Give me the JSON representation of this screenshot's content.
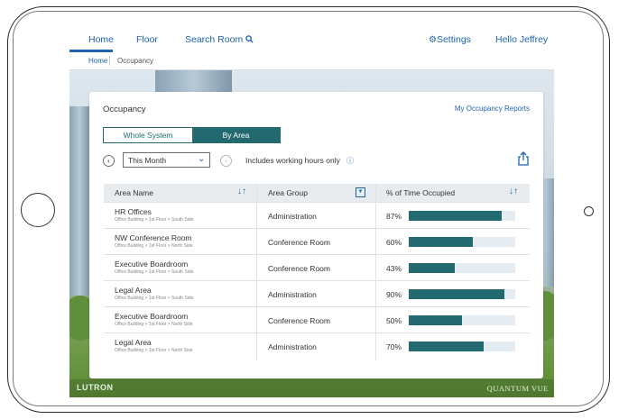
{
  "nav": {
    "home": "Home",
    "floor": "Floor",
    "search_room": "Search Room",
    "settings": "Settings",
    "greeting": "Hello Jeffrey"
  },
  "breadcrumb": {
    "home": "Home",
    "current": "Occupancy"
  },
  "card": {
    "title": "Occupancy",
    "reports_link": "My Occupancy Reports"
  },
  "segmented": {
    "whole_system": "Whole System",
    "by_area": "By Area",
    "selected": "By Area"
  },
  "filter": {
    "period": "This Month",
    "hours_label": "Includes working hours only"
  },
  "table": {
    "headers": {
      "area_name": "Area Name",
      "area_group": "Area Group",
      "time_occupied": "% of Time Occupied"
    },
    "rows": [
      {
        "name": "HR Offices",
        "path": "Office Building > 1st Floor > South Side",
        "group": "Administration",
        "pct_label": "87%",
        "pct": 87
      },
      {
        "name": "NW Conference Room",
        "path": "Office Building > 1st Floor > North Side",
        "group": "Conference Room",
        "pct_label": "60%",
        "pct": 60
      },
      {
        "name": "Executive Boardroom",
        "path": "Office Building > 1st Floor > South Side",
        "group": "Conference Room",
        "pct_label": "43%",
        "pct": 43
      },
      {
        "name": "Legal Area",
        "path": "Office Building > 1st Floor > South Side",
        "group": "Administration",
        "pct_label": "90%",
        "pct": 90
      },
      {
        "name": "Executive Boardroom",
        "path": "Office Building > 1st Floor > North Side",
        "group": "Conference Room",
        "pct_label": "50%",
        "pct": 50
      },
      {
        "name": "Legal Area",
        "path": "Office Building > 1st Floor > North Side",
        "group": "Administration",
        "pct_label": "70%",
        "pct": 70
      }
    ]
  },
  "footer": {
    "brand_left": "LUTRON",
    "brand_right": "QUANTUM VUE"
  },
  "colors": {
    "accent_blue": "#1f63b1",
    "bar_teal": "#226a70",
    "bar_track": "#e4ecf1"
  }
}
